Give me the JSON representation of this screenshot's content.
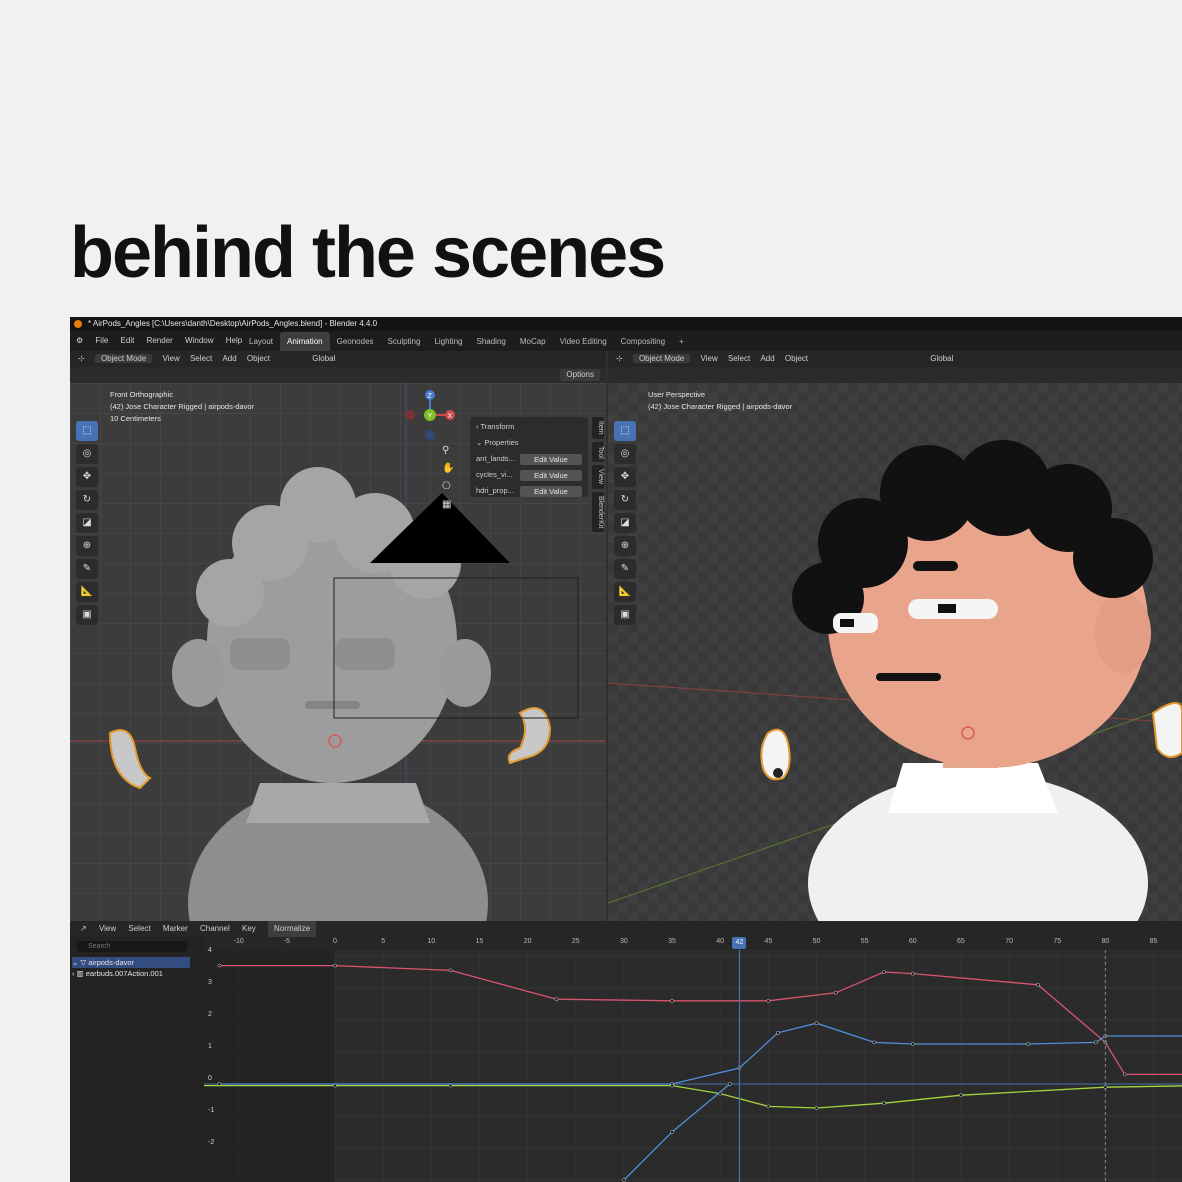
{
  "headline": "behind the scenes",
  "window_title": "* AirPods_Angles [C:\\Users\\danth\\Desktop\\AirPods_Angles.blend] - Blender 4.4.0",
  "menu": [
    "File",
    "Edit",
    "Render",
    "Window",
    "Help"
  ],
  "workspaces": [
    "Layout",
    "Animation",
    "Geonodes",
    "Sculpting",
    "Lighting",
    "Shading",
    "MoCap",
    "Video Editing",
    "Compositing",
    "+"
  ],
  "active_workspace": "Animation",
  "left_viewport": {
    "header": [
      "Object Mode",
      "View",
      "Select",
      "Add",
      "Object"
    ],
    "orientation": "Global",
    "options": "Options",
    "info": [
      "Front Orthographic",
      "(42) Jose Character Rigged | airpods-davor",
      "10 Centimeters"
    ],
    "npanel": {
      "transform": "Transform",
      "properties": "Properties",
      "rows": [
        {
          "label": "ant_lands...",
          "button": "Edit Value"
        },
        {
          "label": "cycles_vi...",
          "button": "Edit Value"
        },
        {
          "label": "hdri_prop...",
          "button": "Edit Value"
        }
      ]
    },
    "side_tabs": [
      "Item",
      "Tool",
      "View",
      "BlenderKit"
    ],
    "gizmo_labels": {
      "z": "Z",
      "y": "Y",
      "x": "X"
    }
  },
  "right_viewport": {
    "header": [
      "Object Mode",
      "View",
      "Select",
      "Add",
      "Object"
    ],
    "orientation": "Global",
    "info": [
      "User Perspective",
      "(42) Jose Character Rigged | airpods-davor"
    ]
  },
  "graph_editor": {
    "header": [
      "View",
      "Select",
      "Marker",
      "Channel",
      "Key"
    ],
    "normalize": "Normalize",
    "search_placeholder": "Search",
    "channels": [
      "airpods-davor",
      "earbuds.007Action.001"
    ],
    "frame_ticks": [
      "-10",
      "-5",
      "0",
      "5",
      "10",
      "15",
      "20",
      "25",
      "30",
      "35",
      "40",
      "45",
      "50",
      "55",
      "60",
      "65",
      "70",
      "75",
      "80",
      "85"
    ],
    "current_frame": "42",
    "value_ticks": [
      "4",
      "3",
      "2",
      "1",
      "0",
      "-1",
      "-2"
    ],
    "colors": {
      "red_curve": "#d9546e",
      "blue_curve": "#4f8fd9",
      "green_curve": "#a4d63c",
      "playhead": "#4772b3"
    }
  }
}
